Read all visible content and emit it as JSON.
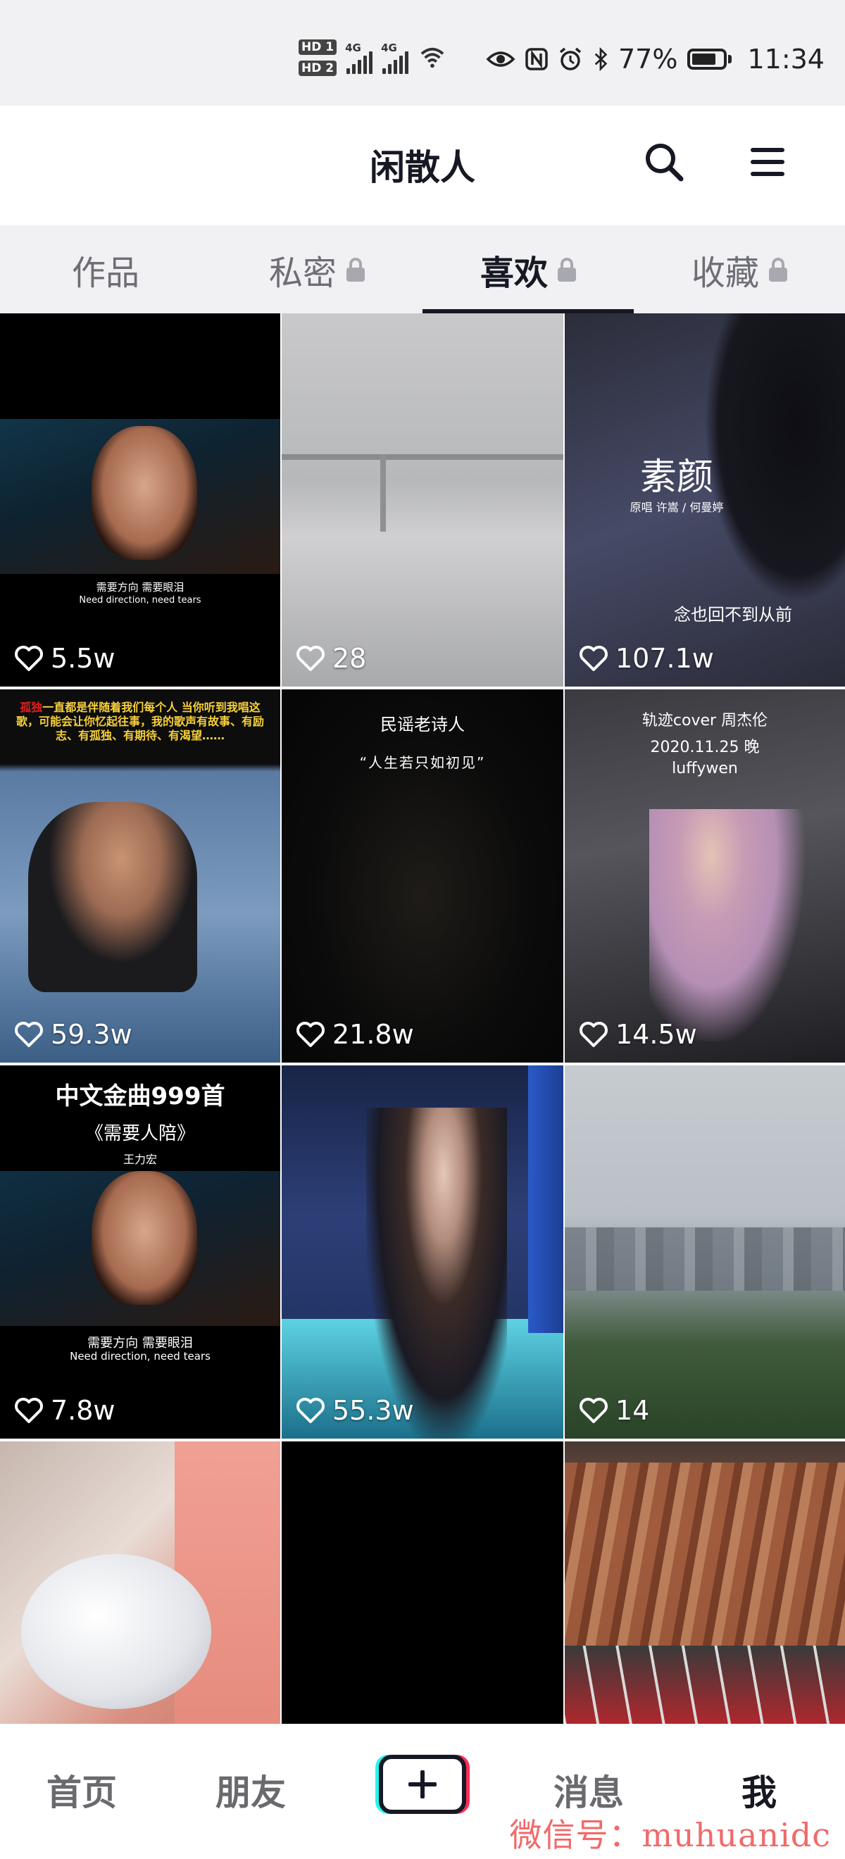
{
  "status_bar": {
    "sim1": "HD 1",
    "sim2": "HD 2",
    "network1": "4G",
    "network2": "4G",
    "battery": "77%",
    "battery_level": 0.77,
    "time": "11:34",
    "icons": [
      "eye-icon",
      "nfc-icon",
      "alarm-icon",
      "bluetooth-icon",
      "wifi-icon"
    ]
  },
  "header": {
    "title": "闲散人",
    "search_icon": "search-icon",
    "menu_icon": "menu-icon"
  },
  "tabs": [
    {
      "label": "作品",
      "locked": false,
      "active": false
    },
    {
      "label": "私密",
      "locked": true,
      "active": false
    },
    {
      "label": "喜欢",
      "locked": true,
      "active": true
    },
    {
      "label": "收藏",
      "locked": true,
      "active": false
    }
  ],
  "videos": [
    {
      "likes": "5.5w",
      "caption_zh": "需要方向 需要眼泪",
      "caption_en": "Need direction, need tears"
    },
    {
      "likes": "28"
    },
    {
      "likes": "107.1w",
      "title": "素颜",
      "credit": "原唱 许嵩 / 何曼婷",
      "lyric": "念也回不到从前"
    },
    {
      "likes": "59.3w",
      "caption_tag": "孤独",
      "caption": "一直都是伴随着我们每个人 当你听到我唱这歌，可能会让你忆起往事，我的歌声有故事、有励志、有孤独、有期待、有渴望……"
    },
    {
      "likes": "21.8w",
      "caption_top": "民谣老诗人",
      "caption_quote": "“人生若只如初见”"
    },
    {
      "likes": "14.5w",
      "caption_line1": "轨迹cover 周杰伦",
      "caption_line2": "2020.11.25 晚",
      "caption_line3": "luffywen"
    },
    {
      "likes": "7.8w",
      "caption_title": "中文金曲999首",
      "caption_song": "《需要人陪》",
      "caption_artist": "王力宏",
      "caption_zh": "需要方向 需要眼泪",
      "caption_en": "Need direction, need tears"
    },
    {
      "likes": "55.3w"
    },
    {
      "likes": "14"
    },
    {
      "likes": ""
    },
    {
      "likes": ""
    },
    {
      "likes": ""
    }
  ],
  "bottom_nav": {
    "home": "首页",
    "friends": "朋友",
    "add_icon": "plus-icon",
    "messages": "消息",
    "me": "我"
  },
  "watermark": "微信号：muhuanidc"
}
